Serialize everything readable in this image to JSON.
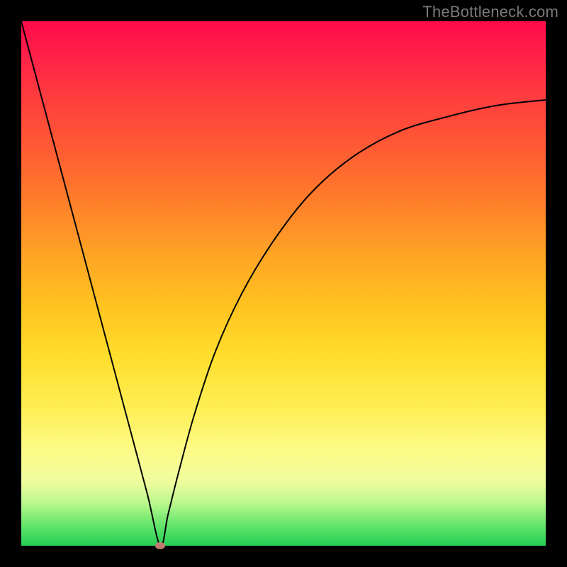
{
  "watermark": "TheBottleneck.com",
  "chart_data": {
    "type": "line",
    "title": "",
    "xlabel": "",
    "ylabel": "",
    "xlim": [
      0,
      1
    ],
    "ylim": [
      0,
      1
    ],
    "grid": false,
    "legend": false,
    "background_gradient": {
      "direction": "vertical",
      "stops": [
        {
          "pos": 0.0,
          "color": "#ff0a4a"
        },
        {
          "pos": 0.24,
          "color": "#ff5a33"
        },
        {
          "pos": 0.54,
          "color": "#ffc21f"
        },
        {
          "pos": 0.82,
          "color": "#fdfb89"
        },
        {
          "pos": 1.0,
          "color": "#23cf55"
        }
      ]
    },
    "series": [
      {
        "name": "bottleneck-curve",
        "x": [
          0.0,
          0.04,
          0.08,
          0.12,
          0.16,
          0.2,
          0.24,
          0.265,
          0.28,
          0.3,
          0.33,
          0.37,
          0.42,
          0.48,
          0.55,
          0.63,
          0.72,
          0.82,
          0.91,
          1.0
        ],
        "y": [
          1.0,
          0.85,
          0.7,
          0.55,
          0.4,
          0.25,
          0.1,
          0.0,
          0.06,
          0.14,
          0.25,
          0.37,
          0.48,
          0.58,
          0.67,
          0.74,
          0.79,
          0.82,
          0.84,
          0.85
        ],
        "color": "#000000",
        "linewidth": 2
      }
    ],
    "annotations": [
      {
        "name": "min-marker",
        "x": 0.265,
        "y": 0.0,
        "color": "#c07b70"
      }
    ]
  }
}
